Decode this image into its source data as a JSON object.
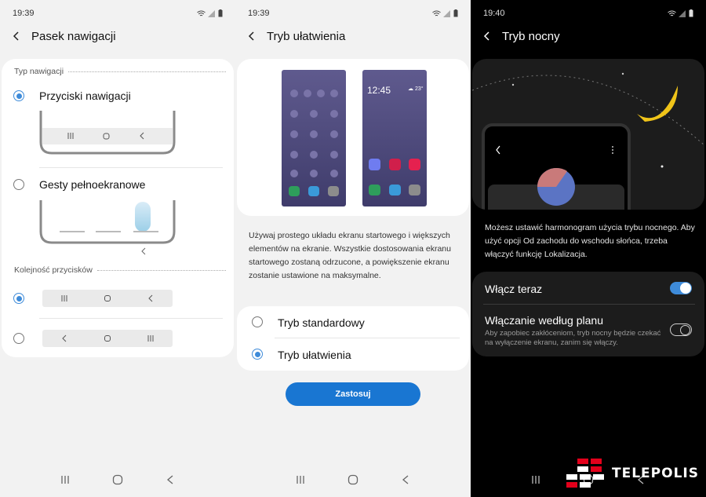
{
  "screen1": {
    "time": "19:39",
    "title": "Pasek nawigacji",
    "section_nav_type": "Typ nawigacji",
    "option_buttons": "Przyciski nawigacji",
    "option_gestures": "Gesty pełnoekranowe",
    "section_order": "Kolejność przycisków",
    "selected_nav_type": "Przyciski nawigacji",
    "selected_order": "recents-home-back"
  },
  "screen2": {
    "time": "19:39",
    "title": "Tryb ułatwienia",
    "preview_time": "12:45",
    "preview_weather": "23°",
    "description": "Używaj prostego układu ekranu startowego i większych elementów na ekranie. Wszystkie dostosowania ekranu startowego zostaną odrzucone, a powiększenie ekranu zostanie ustawione na maksymalne.",
    "option_standard": "Tryb standardowy",
    "option_easy": "Tryb ułatwienia",
    "selected": "Tryb ułatwienia",
    "apply_label": "Zastosuj"
  },
  "screen3": {
    "time": "19:40",
    "title": "Tryb nocny",
    "description": "Możesz ustawić harmonogram użycia trybu nocnego. Aby użyć opcji Od zachodu do wschodu słońca, trzeba włączyć funkcję Lokalizacja.",
    "turn_on_now_label": "Włącz teraz",
    "turn_on_now_state": true,
    "scheduled_label": "Włączanie według planu",
    "scheduled_sub": "Aby zapobiec zakłóceniom, tryb nocny będzie czekać na wyłączenie ekranu, zanim się włączy.",
    "scheduled_state": false
  },
  "watermark": "TELEPOLIS",
  "colors": {
    "accent": "#3e8bd9",
    "apply": "#1976d2"
  }
}
